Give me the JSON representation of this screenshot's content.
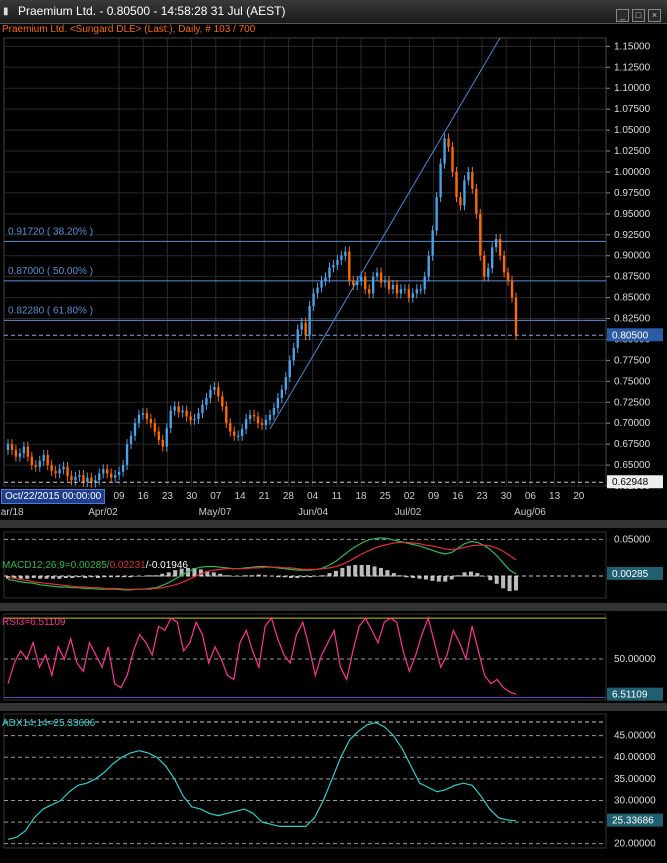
{
  "window": {
    "title": "Praemium Ltd. - 0.80500 - 14:58:28  31 Jul (AEST)",
    "subtitle": "Praemium Ltd. <Sungard DLE> (Last:), Daily, # 103 / 700",
    "buttons": [
      "minimize",
      "restore",
      "close"
    ]
  },
  "colors": {
    "background": "#000000",
    "grid": "#2a2a2a",
    "up_candle": "#4aa3e8",
    "down_candle": "#ff6a00",
    "fib": "#5a8fd6",
    "trendline": "#4a88d8",
    "macd": "#2fb84e",
    "macd_signal": "#e03030",
    "rsi": "#ff3399",
    "adx": "#2ad0d0"
  },
  "crosshair_date": "Oct/22/2015 00:00:00",
  "chart_data": [
    {
      "type": "candlestick",
      "name": "price",
      "ylim": [
        0.625,
        1.16
      ],
      "y_ticks": [
        "1.15000",
        "1.12500",
        "1.10000",
        "1.07500",
        "1.05000",
        "1.02500",
        "1.00000",
        "0.97500",
        "0.95000",
        "0.92500",
        "0.90000",
        "0.87500",
        "0.85000",
        "0.82500",
        "0.80000",
        "0.77500",
        "0.75000",
        "0.72500",
        "0.70000",
        "0.67500",
        "0.65000",
        "0.62500"
      ],
      "last_price": "0.80500",
      "low_marker": "0.62948",
      "x_ticks": [
        "09",
        "16",
        "23",
        "30",
        "07",
        "14",
        "21",
        "28",
        "04",
        "11",
        "18",
        "25",
        "02",
        "09",
        "16",
        "23",
        "30",
        "06",
        "13",
        "20"
      ],
      "month_labels": [
        "Mar/18",
        "Apr/02",
        "May/07",
        "Jun/04",
        "Jul/02",
        "Aug/06"
      ],
      "fibonacci": [
        {
          "value": 0.9172,
          "label": "0.91720 ( 38.20% )"
        },
        {
          "value": 0.87,
          "label": "0.87000 ( 50.00% )"
        },
        {
          "value": 0.8228,
          "label": "0.82280 ( 61.80% )"
        }
      ],
      "closes": [
        0.675,
        0.668,
        0.66,
        0.664,
        0.672,
        0.66,
        0.65,
        0.648,
        0.655,
        0.662,
        0.65,
        0.643,
        0.64,
        0.645,
        0.648,
        0.637,
        0.632,
        0.636,
        0.638,
        0.63,
        0.635,
        0.629,
        0.632,
        0.64,
        0.645,
        0.64,
        0.635,
        0.638,
        0.642,
        0.65,
        0.675,
        0.685,
        0.7,
        0.71,
        0.712,
        0.705,
        0.7,
        0.69,
        0.68,
        0.672,
        0.694,
        0.715,
        0.72,
        0.713,
        0.715,
        0.708,
        0.704,
        0.705,
        0.712,
        0.722,
        0.73,
        0.74,
        0.743,
        0.732,
        0.72,
        0.7,
        0.69,
        0.685,
        0.685,
        0.693,
        0.705,
        0.71,
        0.708,
        0.7,
        0.698,
        0.704,
        0.71,
        0.718,
        0.73,
        0.74,
        0.755,
        0.775,
        0.79,
        0.812,
        0.82,
        0.805,
        0.84,
        0.855,
        0.862,
        0.87,
        0.874,
        0.886,
        0.889,
        0.895,
        0.9,
        0.905,
        0.87,
        0.865,
        0.87,
        0.875,
        0.86,
        0.855,
        0.875,
        0.88,
        0.868,
        0.87,
        0.86,
        0.865,
        0.855,
        0.86,
        0.86,
        0.85,
        0.855,
        0.86,
        0.86,
        0.875,
        0.9,
        0.93,
        0.97,
        1.01,
        1.04,
        1.03,
        1.0,
        0.97,
        0.96,
        0.99,
        1.0,
        0.98,
        0.95,
        0.9,
        0.875,
        0.885,
        0.91,
        0.92,
        0.9,
        0.88,
        0.87,
        0.85,
        0.805
      ],
      "opens": [
        0.668,
        0.675,
        0.668,
        0.66,
        0.664,
        0.672,
        0.66,
        0.65,
        0.648,
        0.655,
        0.662,
        0.65,
        0.643,
        0.64,
        0.645,
        0.648,
        0.637,
        0.632,
        0.636,
        0.638,
        0.63,
        0.635,
        0.629,
        0.632,
        0.64,
        0.645,
        0.64,
        0.635,
        0.638,
        0.642,
        0.65,
        0.675,
        0.685,
        0.7,
        0.71,
        0.712,
        0.705,
        0.7,
        0.69,
        0.68,
        0.672,
        0.694,
        0.715,
        0.72,
        0.713,
        0.715,
        0.708,
        0.704,
        0.705,
        0.712,
        0.722,
        0.73,
        0.74,
        0.743,
        0.732,
        0.72,
        0.7,
        0.69,
        0.685,
        0.685,
        0.693,
        0.705,
        0.71,
        0.708,
        0.7,
        0.698,
        0.704,
        0.71,
        0.718,
        0.73,
        0.74,
        0.755,
        0.775,
        0.79,
        0.812,
        0.82,
        0.805,
        0.84,
        0.855,
        0.862,
        0.87,
        0.874,
        0.886,
        0.889,
        0.895,
        0.9,
        0.905,
        0.87,
        0.865,
        0.87,
        0.875,
        0.86,
        0.855,
        0.875,
        0.88,
        0.868,
        0.87,
        0.86,
        0.865,
        0.855,
        0.86,
        0.86,
        0.85,
        0.855,
        0.86,
        0.86,
        0.875,
        0.9,
        0.93,
        0.97,
        1.01,
        1.04,
        1.03,
        1.0,
        0.97,
        0.96,
        0.99,
        1.0,
        0.98,
        0.95,
        0.9,
        0.875,
        0.885,
        0.91,
        0.92,
        0.9,
        0.88,
        0.87,
        0.85
      ]
    },
    {
      "type": "line",
      "name": "MACD",
      "label": "MACD12;26;9=0.00285/",
      "signal_label": "0.02231",
      "hist_label": "/-0.01946",
      "ylim": [
        -0.03,
        0.06
      ],
      "y_ticks": [
        "0.05000"
      ],
      "last_value": "0.00285",
      "macd": [
        -0.005,
        -0.006,
        -0.008,
        -0.009,
        -0.01,
        -0.012,
        -0.013,
        -0.014,
        -0.015,
        -0.015,
        -0.016,
        -0.016,
        -0.017,
        -0.017,
        -0.018,
        -0.018,
        -0.018,
        -0.018,
        -0.019,
        -0.019,
        -0.018,
        -0.018,
        -0.017,
        -0.016,
        -0.013,
        -0.009,
        -0.004,
        0.001,
        0.006,
        0.01,
        0.012,
        0.013,
        0.013,
        0.012,
        0.011,
        0.01,
        0.01,
        0.011,
        0.012,
        0.013,
        0.013,
        0.012,
        0.011,
        0.01,
        0.009,
        0.008,
        0.008,
        0.008,
        0.009,
        0.011,
        0.015,
        0.02,
        0.027,
        0.034,
        0.04,
        0.045,
        0.049,
        0.051,
        0.052,
        0.051,
        0.049,
        0.047,
        0.045,
        0.043,
        0.041,
        0.038,
        0.035,
        0.032,
        0.03,
        0.032,
        0.038,
        0.044,
        0.047,
        0.046,
        0.042,
        0.036,
        0.028,
        0.018,
        0.008,
        0.003
      ],
      "signal": [
        -0.002,
        -0.003,
        -0.005,
        -0.006,
        -0.008,
        -0.009,
        -0.01,
        -0.011,
        -0.012,
        -0.013,
        -0.014,
        -0.015,
        -0.015,
        -0.016,
        -0.016,
        -0.017,
        -0.017,
        -0.017,
        -0.018,
        -0.018,
        -0.018,
        -0.018,
        -0.018,
        -0.017,
        -0.016,
        -0.014,
        -0.012,
        -0.009,
        -0.005,
        -0.001,
        0.003,
        0.006,
        0.008,
        0.009,
        0.01,
        0.01,
        0.01,
        0.01,
        0.011,
        0.011,
        0.012,
        0.012,
        0.012,
        0.011,
        0.011,
        0.01,
        0.009,
        0.009,
        0.009,
        0.01,
        0.011,
        0.013,
        0.016,
        0.02,
        0.025,
        0.03,
        0.034,
        0.038,
        0.041,
        0.043,
        0.045,
        0.046,
        0.046,
        0.045,
        0.044,
        0.042,
        0.041,
        0.039,
        0.037,
        0.036,
        0.037,
        0.039,
        0.041,
        0.042,
        0.042,
        0.041,
        0.038,
        0.034,
        0.028,
        0.022
      ]
    },
    {
      "type": "line",
      "name": "RSI",
      "label": "RSI3=6.51109",
      "ylim": [
        0,
        105
      ],
      "y_ticks": [
        "50.00000"
      ],
      "last_value": "6.51109",
      "values": [
        20,
        45,
        60,
        50,
        70,
        40,
        55,
        30,
        65,
        50,
        75,
        45,
        35,
        70,
        55,
        40,
        65,
        20,
        15,
        30,
        60,
        80,
        70,
        55,
        90,
        85,
        100,
        95,
        60,
        70,
        95,
        80,
        45,
        65,
        50,
        30,
        25,
        70,
        85,
        60,
        40,
        90,
        100,
        75,
        55,
        45,
        80,
        95,
        65,
        30,
        55,
        70,
        85,
        40,
        25,
        60,
        90,
        100,
        85,
        70,
        95,
        100,
        95,
        60,
        35,
        55,
        80,
        100,
        70,
        40,
        55,
        85,
        70,
        50,
        90,
        60,
        30,
        20,
        25,
        15,
        10,
        7
      ]
    },
    {
      "type": "line",
      "name": "ADX",
      "label": "ADX14;14=25.33686",
      "ylim": [
        19,
        50
      ],
      "y_ticks": [
        "45.00000",
        "40.00000",
        "35.00000",
        "30.00000",
        "25.00000",
        "20.00000"
      ],
      "last_value": "25.33686",
      "values": [
        21,
        21.5,
        23,
        26,
        28,
        29,
        30,
        32,
        33.5,
        34,
        35,
        36.5,
        38.5,
        40,
        41,
        41.5,
        41,
        40,
        38,
        35,
        31,
        28.5,
        28,
        27,
        26.5,
        27,
        27.5,
        28,
        27,
        25,
        24.5,
        24,
        24,
        24,
        24,
        26,
        30,
        35,
        40,
        44,
        46,
        47.5,
        48,
        47,
        45,
        42,
        38,
        34,
        33,
        32,
        32.5,
        33.5,
        34,
        33.5,
        31,
        28,
        26,
        25.5,
        25.3
      ]
    }
  ]
}
